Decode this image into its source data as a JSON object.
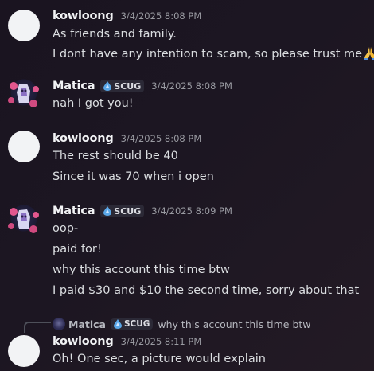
{
  "messages": [
    {
      "user": "kowloong",
      "timestamp": "3/4/2025 8:08 PM",
      "lines": [
        "As friends and family.",
        "I dont have any intention to scam, so please trust me"
      ],
      "emoji": "folded-hands-emoji"
    },
    {
      "user": "Matica",
      "tag": "SCUG",
      "timestamp": "3/4/2025 8:08 PM",
      "lines": [
        "nah I got you!"
      ]
    },
    {
      "user": "kowloong",
      "timestamp": "3/4/2025 8:08 PM",
      "lines": [
        "The rest should be 40",
        "Since it was 70 when i open"
      ]
    },
    {
      "user": "Matica",
      "tag": "SCUG",
      "timestamp": "3/4/2025 8:09 PM",
      "lines": [
        "oop-",
        "paid for!",
        "why this account this time btw",
        "I paid $30 and $10 the second time, sorry about that"
      ]
    },
    {
      "reply": {
        "user": "Matica",
        "tag": "SCUG",
        "text": "why this account this time btw"
      },
      "user": "kowloong",
      "timestamp": "3/4/2025 8:11 PM",
      "lines": [
        "Oh! One sec, a picture would explain"
      ]
    }
  ],
  "colors": {
    "background": "#1c1622",
    "text": "#dbdee1",
    "username": "#f2f3f5",
    "timestamp": "#9a9ba2",
    "tag_bg": "#2b2936",
    "tag_icon": "#5aa7e8"
  }
}
